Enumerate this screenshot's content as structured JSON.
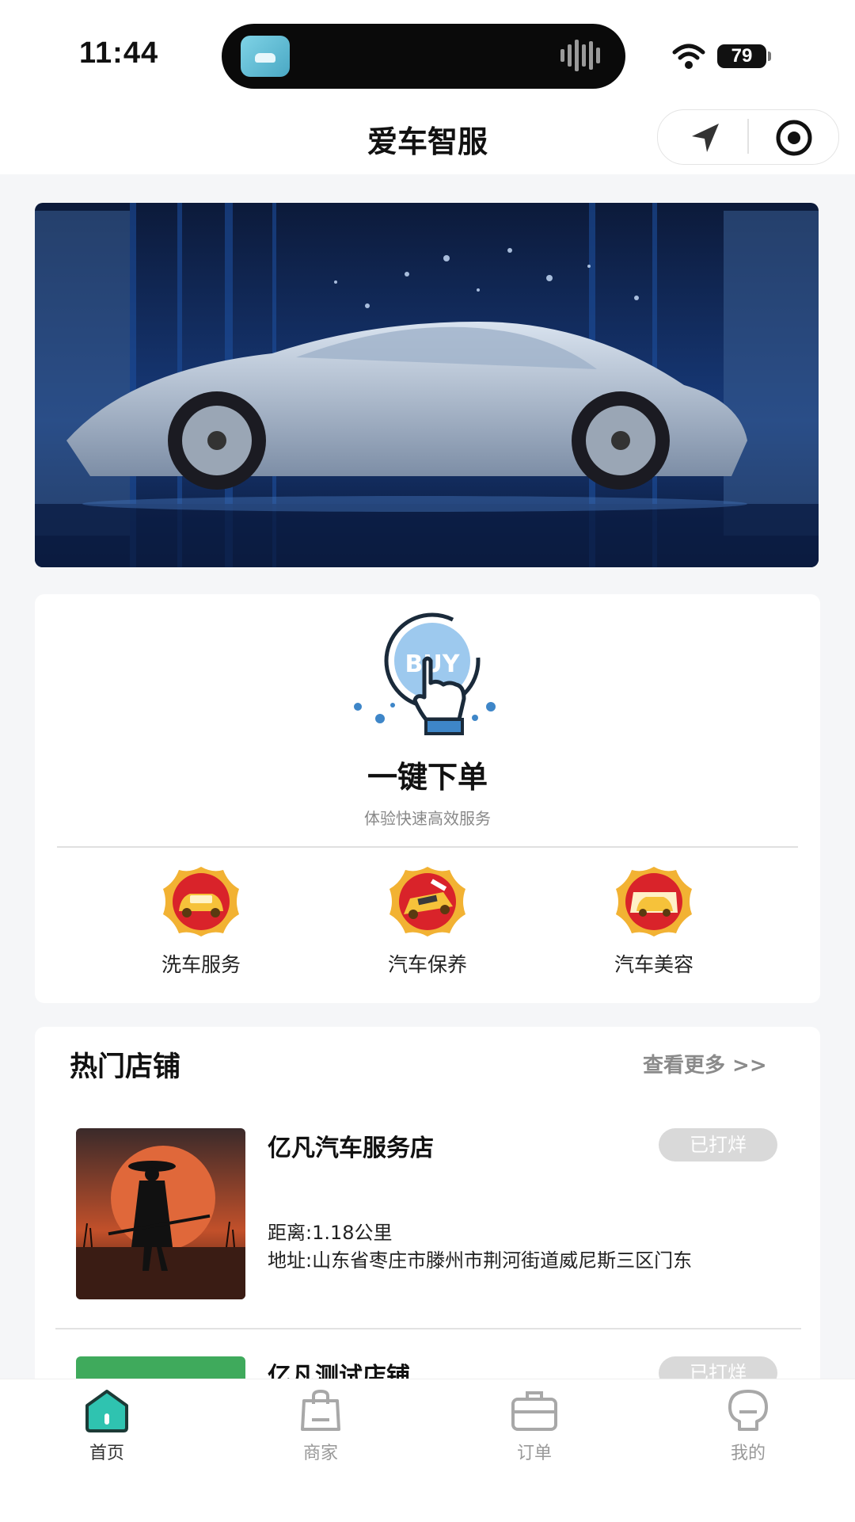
{
  "status_bar": {
    "time": "11:44",
    "battery": "79"
  },
  "nav": {
    "title": "爱车智服"
  },
  "quick_order": {
    "title": "一键下单",
    "subtitle": "体验快速高效服务",
    "buy_label": "BUY",
    "services": [
      {
        "label": "洗车服务",
        "icon": "car-wash-icon"
      },
      {
        "label": "汽车保养",
        "icon": "car-maintenance-icon"
      },
      {
        "label": "汽车美容",
        "icon": "car-beauty-icon"
      }
    ]
  },
  "hot_shops": {
    "title": "热门店铺",
    "more": "查看更多 >>",
    "shops": [
      {
        "name": "亿凡汽车服务店",
        "status": "已打烊",
        "distance": "距离:1.18公里",
        "address": "地址:山东省枣庄市滕州市荆河街道威尼斯三区门东"
      },
      {
        "name": "亿凡测试店铺",
        "status": "已打烊"
      }
    ]
  },
  "tabs": [
    {
      "label": "首页",
      "icon": "home-icon",
      "active": true
    },
    {
      "label": "商家",
      "icon": "shopping-bag-icon",
      "active": false
    },
    {
      "label": "订单",
      "icon": "briefcase-icon",
      "active": false
    },
    {
      "label": "我的",
      "icon": "profile-icon",
      "active": false
    }
  ],
  "colors": {
    "accent": "#2fc3b0",
    "closed_badge": "#d9d9d9"
  }
}
